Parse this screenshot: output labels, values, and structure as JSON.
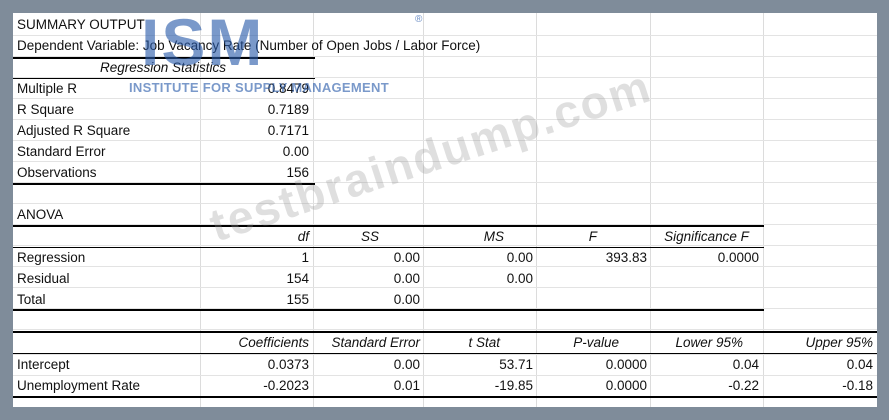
{
  "title": "SUMMARY OUTPUT",
  "dependent_variable": "Dependent Variable: Job Vacancy Rate (Number of Open Jobs / Labor Force)",
  "regression_statistics": {
    "heading": "Regression Statistics",
    "rows": [
      {
        "label": "Multiple R",
        "value": "0.8479"
      },
      {
        "label": "R Square",
        "value": "0.7189"
      },
      {
        "label": "Adjusted R Square",
        "value": "0.7171"
      },
      {
        "label": "Standard Error",
        "value": "0.00"
      },
      {
        "label": "Observations",
        "value": "156"
      }
    ]
  },
  "anova": {
    "heading": "ANOVA",
    "columns": [
      "",
      "df",
      "SS",
      "MS",
      "F",
      "Significance F"
    ],
    "rows": [
      [
        "Regression",
        "1",
        "0.00",
        "0.00",
        "393.83",
        "0.0000"
      ],
      [
        "Residual",
        "154",
        "0.00",
        "0.00",
        "",
        ""
      ],
      [
        "Total",
        "155",
        "0.00",
        "",
        "",
        ""
      ]
    ]
  },
  "coefficients": {
    "columns": [
      "",
      "Coefficients",
      "Standard Error",
      "t Stat",
      "P-value",
      "Lower 95%",
      "Upper 95%"
    ],
    "rows": [
      [
        "Intercept",
        "0.0373",
        "0.00",
        "53.71",
        "0.0000",
        "0.04",
        "0.04"
      ],
      [
        "Unemployment Rate",
        "-0.2023",
        "0.01",
        "-19.85",
        "0.0000",
        "-0.22",
        "-0.18"
      ]
    ]
  },
  "watermarks": {
    "logo": "ISM",
    "registered": "®",
    "institute": "INSTITUTE FOR SUPPLY MANAGEMENT",
    "site": "testbraindump.com"
  },
  "colors": {
    "frame": "#7f8c9a",
    "logo": "#285aaa"
  }
}
